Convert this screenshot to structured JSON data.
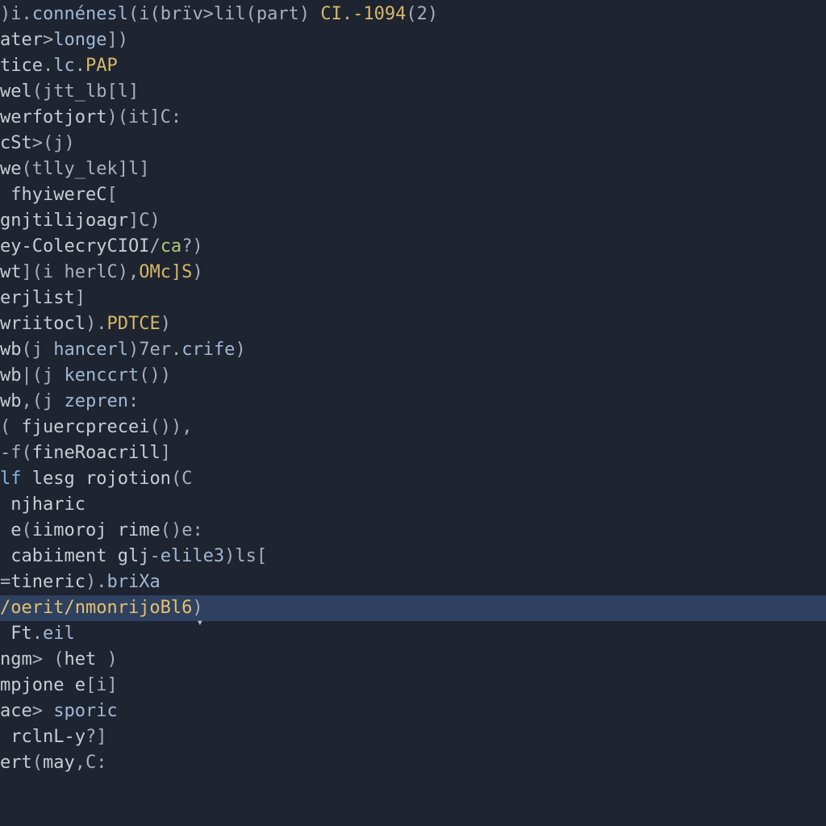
{
  "editor": {
    "lines": [
      {
        "class": "",
        "segments": [
          {
            "cls": "t-punc",
            "t": ")i."
          },
          {
            "cls": "t-prop",
            "t": "connénesl"
          },
          {
            "cls": "t-punc",
            "t": "(i(brïv>lil(part) "
          },
          {
            "cls": "t-type",
            "t": "CI.-1094"
          },
          {
            "cls": "t-punc",
            "t": "(2)"
          }
        ]
      },
      {
        "class": "",
        "segments": [
          {
            "cls": "t-ident",
            "t": "ater"
          },
          {
            "cls": "t-punc",
            "t": ">"
          },
          {
            "cls": "t-prop",
            "t": "longe"
          },
          {
            "cls": "t-punc",
            "t": "])"
          }
        ]
      },
      {
        "class": "",
        "segments": [
          {
            "cls": "t-ident",
            "t": "tice"
          },
          {
            "cls": "t-punc",
            "t": "."
          },
          {
            "cls": "t-prop",
            "t": "lc"
          },
          {
            "cls": "t-punc",
            "t": "."
          },
          {
            "cls": "t-type",
            "t": "PAP"
          }
        ]
      },
      {
        "class": "",
        "segments": [
          {
            "cls": "t-ident",
            "t": "wel"
          },
          {
            "cls": "t-punc",
            "t": "(jtt_lb[l]"
          }
        ]
      },
      {
        "class": "",
        "segments": [
          {
            "cls": "t-ident",
            "t": "werfotjort"
          },
          {
            "cls": "t-punc",
            "t": ")(it]C:"
          }
        ]
      },
      {
        "class": "",
        "segments": [
          {
            "cls": "t-ident",
            "t": "cSt"
          },
          {
            "cls": "t-punc",
            "t": ">(j)"
          }
        ]
      },
      {
        "class": "",
        "segments": [
          {
            "cls": "t-ident",
            "t": "we"
          },
          {
            "cls": "t-punc",
            "t": "(tlly_lek]l]"
          }
        ]
      },
      {
        "class": "",
        "segments": [
          {
            "cls": "t-ident",
            "t": " fhyiwereC"
          },
          {
            "cls": "t-punc",
            "t": "["
          }
        ]
      },
      {
        "class": "",
        "segments": [
          {
            "cls": "t-ident",
            "t": "gnjtilijoagr"
          },
          {
            "cls": "t-punc",
            "t": "]C)"
          }
        ]
      },
      {
        "class": "",
        "segments": [
          {
            "cls": "t-ident",
            "t": "ey-ColecryCIOI"
          },
          {
            "cls": "t-punc",
            "t": "/"
          },
          {
            "cls": "t-str",
            "t": "ca"
          },
          {
            "cls": "t-punc",
            "t": "?)"
          }
        ]
      },
      {
        "class": "",
        "segments": [
          {
            "cls": "t-ident",
            "t": "wt"
          },
          {
            "cls": "t-punc",
            "t": "](i herlC),"
          },
          {
            "cls": "t-type",
            "t": "OMc]S"
          },
          {
            "cls": "t-punc",
            "t": ")"
          }
        ]
      },
      {
        "class": "",
        "segments": [
          {
            "cls": "t-ident",
            "t": "erjlist"
          },
          {
            "cls": "t-punc",
            "t": "]"
          }
        ]
      },
      {
        "class": "",
        "segments": [
          {
            "cls": "t-ident",
            "t": "wriitocl"
          },
          {
            "cls": "t-punc",
            "t": ")."
          },
          {
            "cls": "t-type",
            "t": "PDTCE"
          },
          {
            "cls": "t-punc",
            "t": ")"
          }
        ]
      },
      {
        "class": "",
        "segments": [
          {
            "cls": "t-ident",
            "t": "wb"
          },
          {
            "cls": "t-punc",
            "t": "(j "
          },
          {
            "cls": "t-prop",
            "t": "hancerl"
          },
          {
            "cls": "t-punc",
            "t": ")7er."
          },
          {
            "cls": "t-prop",
            "t": "crife"
          },
          {
            "cls": "t-punc",
            "t": ")"
          }
        ]
      },
      {
        "class": "",
        "segments": [
          {
            "cls": "t-ident",
            "t": "wb"
          },
          {
            "cls": "t-punc",
            "t": "|(j "
          },
          {
            "cls": "t-prop",
            "t": "kenccrt"
          },
          {
            "cls": "t-punc",
            "t": "())"
          }
        ]
      },
      {
        "class": "",
        "segments": [
          {
            "cls": "t-ident",
            "t": "wb"
          },
          {
            "cls": "t-punc",
            "t": ",(j "
          },
          {
            "cls": "t-prop",
            "t": "zepren"
          },
          {
            "cls": "t-punc",
            "t": ":"
          }
        ]
      },
      {
        "class": "",
        "segments": [
          {
            "cls": "t-punc",
            "t": "( "
          },
          {
            "cls": "t-ident",
            "t": "fjuercprecei"
          },
          {
            "cls": "t-punc",
            "t": "()),"
          }
        ]
      },
      {
        "class": "",
        "segments": [
          {
            "cls": "t-punc",
            "t": "-f("
          },
          {
            "cls": "t-ident",
            "t": "fineRoacrill"
          },
          {
            "cls": "t-punc",
            "t": "]"
          }
        ]
      },
      {
        "class": "",
        "segments": [
          {
            "cls": "t-kw",
            "t": "lf"
          },
          {
            "cls": "t-ident",
            "t": " lesg rojotion"
          },
          {
            "cls": "t-punc",
            "t": "(C"
          }
        ]
      },
      {
        "class": "",
        "segments": [
          {
            "cls": "t-ident",
            "t": " njharic"
          }
        ]
      },
      {
        "class": "",
        "segments": [
          {
            "cls": "t-ident",
            "t": " e"
          },
          {
            "cls": "t-punc",
            "t": "("
          },
          {
            "cls": "t-ident",
            "t": "iimoroj rime"
          },
          {
            "cls": "t-punc",
            "t": "()e:"
          }
        ]
      },
      {
        "class": "",
        "segments": [
          {
            "cls": "t-ident",
            "t": " cabiiment glj"
          },
          {
            "cls": "t-punc",
            "t": "-"
          },
          {
            "cls": "t-prop",
            "t": "elile3"
          },
          {
            "cls": "t-punc",
            "t": ")ls["
          }
        ]
      },
      {
        "class": "",
        "segments": [
          {
            "cls": "t-punc",
            "t": "="
          },
          {
            "cls": "t-ident",
            "t": "tineric"
          },
          {
            "cls": "t-punc",
            "t": ")."
          },
          {
            "cls": "t-prop",
            "t": "briXa"
          }
        ]
      },
      {
        "class": "cursor-line",
        "segments": [
          {
            "cls": "t-hi",
            "t": "/oerit/nmonrijoBl6"
          },
          {
            "cls": "t-punc",
            "t": ")"
          }
        ]
      },
      {
        "class": "",
        "segments": [
          {
            "cls": "t-ident",
            "t": " Ft"
          },
          {
            "cls": "t-punc",
            "t": "."
          },
          {
            "cls": "t-prop",
            "t": "eil"
          }
        ]
      },
      {
        "class": "",
        "segments": [
          {
            "cls": "t-ident",
            "t": "ngm"
          },
          {
            "cls": "t-punc",
            "t": "> ("
          },
          {
            "cls": "t-ident",
            "t": "het "
          },
          {
            "cls": "t-punc",
            "t": ")"
          }
        ]
      },
      {
        "class": "",
        "segments": [
          {
            "cls": "t-ident",
            "t": "mpjone e"
          },
          {
            "cls": "t-punc",
            "t": "[i]"
          }
        ]
      },
      {
        "class": "",
        "segments": [
          {
            "cls": "t-ident",
            "t": "ace"
          },
          {
            "cls": "t-punc",
            "t": "> "
          },
          {
            "cls": "t-prop",
            "t": "sporic"
          }
        ]
      },
      {
        "class": "",
        "segments": [
          {
            "cls": "t-ident",
            "t": " rclnL-y"
          },
          {
            "cls": "t-punc",
            "t": "?]"
          }
        ]
      },
      {
        "class": "",
        "segments": [
          {
            "cls": "t-ident",
            "t": "ert"
          },
          {
            "cls": "t-punc",
            "t": "("
          },
          {
            "cls": "t-ident",
            "t": "may"
          },
          {
            "cls": "t-punc",
            "t": ",C:"
          }
        ]
      }
    ],
    "highlighted_index": 23,
    "chevron_glyph": "▾"
  },
  "colors": {
    "background": "#1e2430",
    "foreground": "#c8ccd4",
    "highlight_bg": "#3d5a8a",
    "highlight_fg": "#e6c06a"
  }
}
